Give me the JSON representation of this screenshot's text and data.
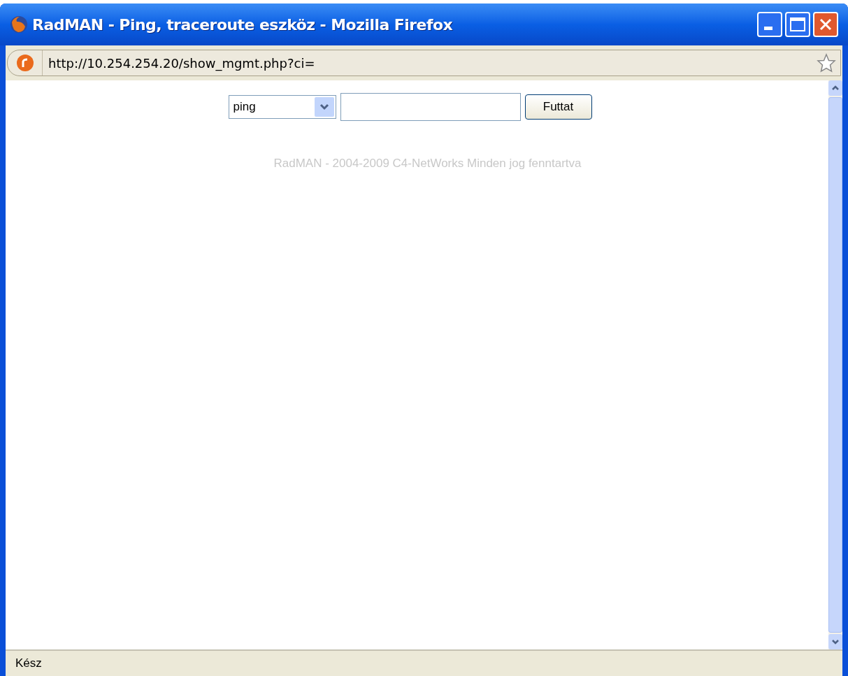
{
  "window": {
    "title": "RadMAN - Ping, traceroute eszköz - Mozilla Firefox"
  },
  "address_bar": {
    "url": "http://10.254.254.20/show_mgmt.php?ci="
  },
  "form": {
    "select": {
      "value": "ping"
    },
    "button": "Futtat"
  },
  "footer": "RadMAN - 2004-2009 C4-NetWorks Minden jog fenntartva",
  "status_bar": {
    "text": "Kész"
  }
}
